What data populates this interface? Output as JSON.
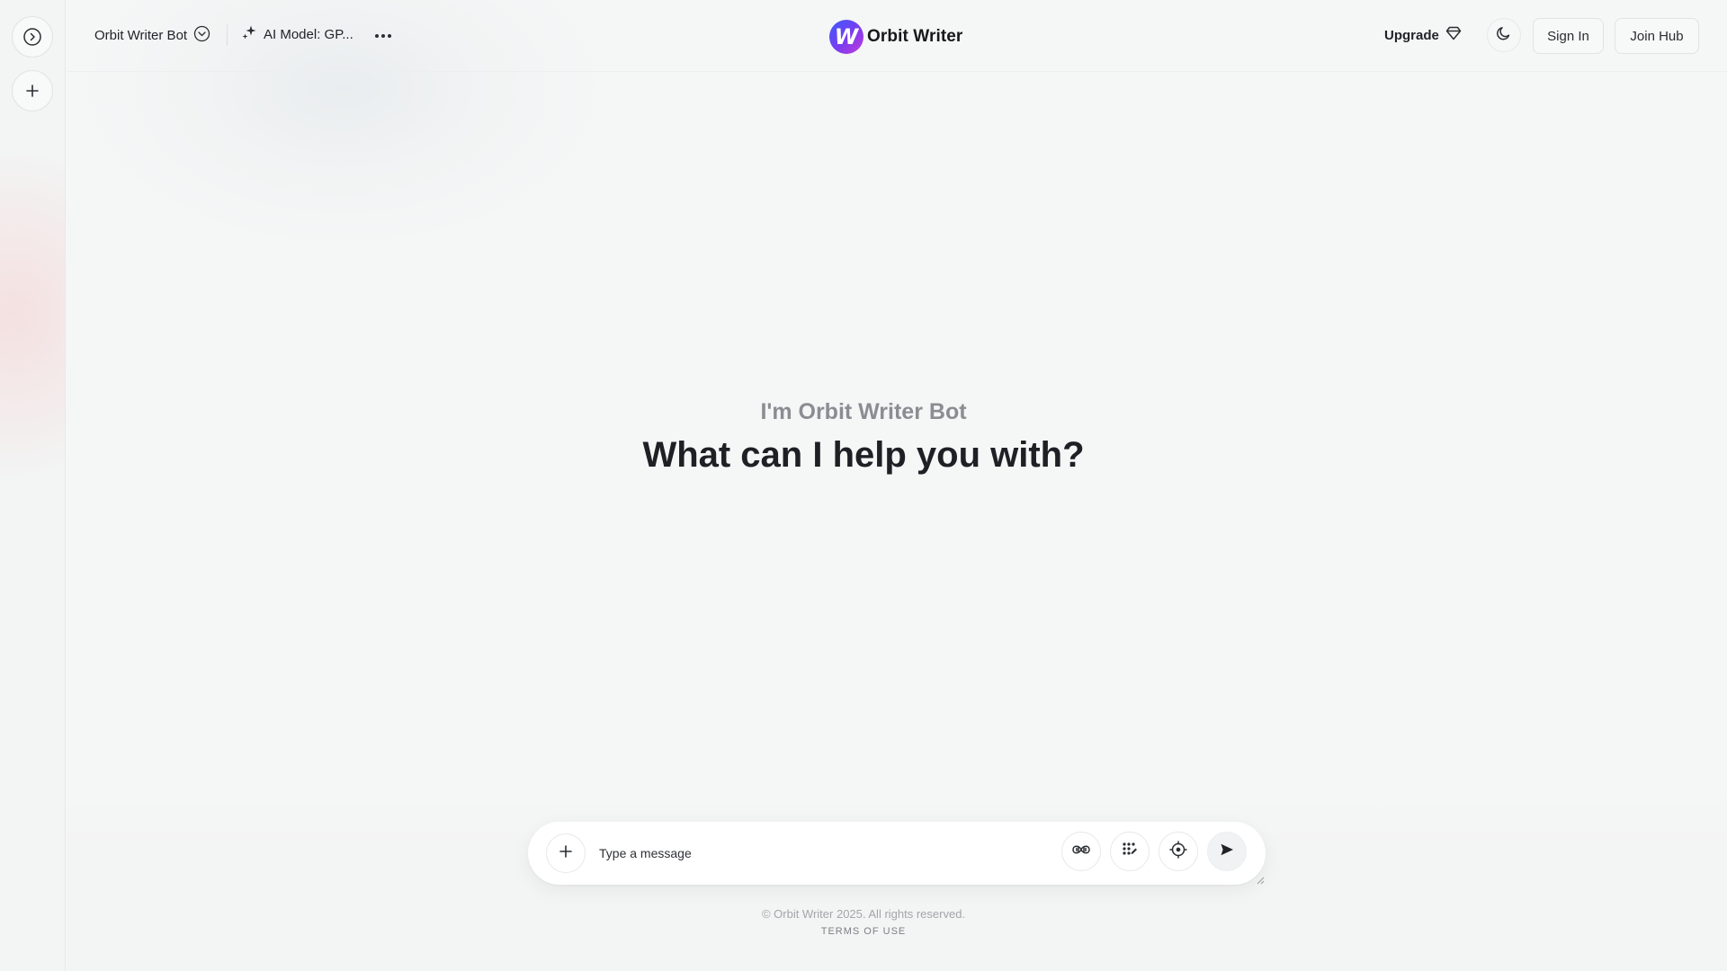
{
  "app": {
    "name": "Orbit Writer",
    "logo_letter": "W"
  },
  "header": {
    "bot_name": "Orbit Writer Bot",
    "model_label": "AI Model: GP...",
    "upgrade_label": "Upgrade",
    "sign_in_label": "Sign In",
    "join_hub_label": "Join Hub"
  },
  "hero": {
    "subtitle": "I'm Orbit Writer Bot",
    "title": "What can I help you with?"
  },
  "composer": {
    "placeholder": "Type a message",
    "value": ""
  },
  "footer": {
    "copyright": "© Orbit Writer 2025. All rights reserved.",
    "terms": "TERMS OF USE"
  },
  "icons": {
    "rail": [
      "expand-sidebar-icon",
      "new-chat-icon"
    ],
    "header": [
      "chevron-down-icon",
      "sparkle-icon",
      "more-icon",
      "diamond-icon",
      "moon-icon"
    ],
    "composer": [
      "plus-icon",
      "voice-icon",
      "grid-icon",
      "target-icon",
      "send-icon"
    ]
  },
  "colors": {
    "background": "#f5f6f6",
    "brand_gradient_start": "#3b5bff",
    "brand_gradient_end": "#c63ad8",
    "text_primary": "#1d2024",
    "text_muted": "#8a8d91"
  }
}
